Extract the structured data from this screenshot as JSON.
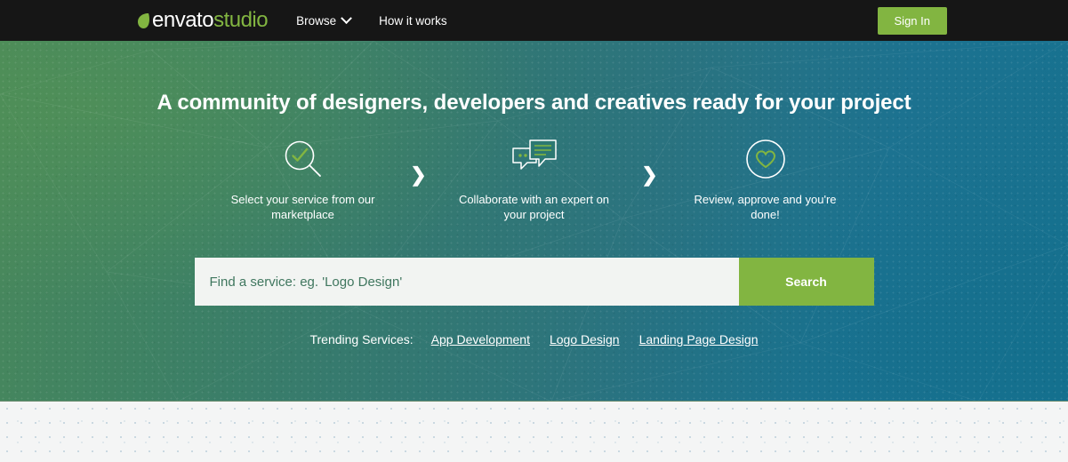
{
  "brand": {
    "name_primary": "envato",
    "name_secondary": "studio",
    "leaf_icon": "leaf-icon",
    "green": "#82b541"
  },
  "nav": {
    "items": [
      {
        "label": "Browse",
        "has_dropdown": true,
        "icon": "chevron-down-icon"
      },
      {
        "label": "How it works",
        "has_dropdown": false
      }
    ],
    "sign_in_label": "Sign In"
  },
  "hero": {
    "headline": "A community of designers, developers and creatives ready for your project",
    "arrow_glyph": "❯",
    "steps": [
      {
        "icon": "magnifier-check-icon",
        "label": "Select your service from our marketplace"
      },
      {
        "icon": "speech-bubbles-icon",
        "label": "Collaborate with an expert on your project"
      },
      {
        "icon": "heart-circle-icon",
        "label": "Review, approve and you're done!"
      }
    ],
    "search": {
      "placeholder": "Find a service: eg. 'Logo Design'",
      "value": "",
      "button_label": "Search"
    },
    "trending": {
      "label": "Trending Services:",
      "links": [
        {
          "label": "App Development"
        },
        {
          "label": "Logo Design"
        },
        {
          "label": "Landing Page Design"
        }
      ]
    }
  }
}
